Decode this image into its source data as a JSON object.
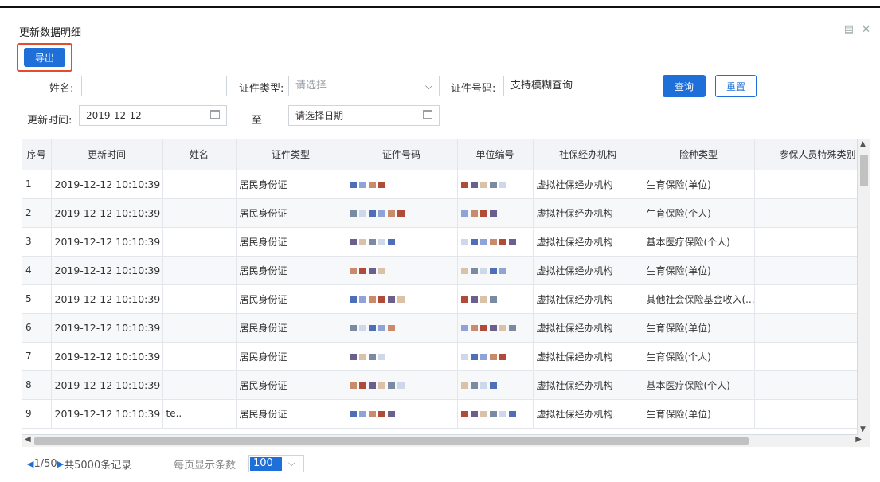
{
  "window": {
    "title": "更新数据明细"
  },
  "toolbar": {
    "export_label": "导出"
  },
  "filters": {
    "name_label": "姓名:",
    "id_type_label": "证件类型:",
    "id_type_placeholder": "请选择",
    "id_no_label": "证件号码:",
    "id_no_value": "支持模糊查询",
    "update_time_label": "更新时间:",
    "update_time_from": "2019-12-12",
    "to_label": "至",
    "update_time_to_placeholder": "请选择日期",
    "search_label": "查询",
    "reset_label": "重置"
  },
  "table": {
    "columns": [
      "序号",
      "更新时间",
      "姓名",
      "证件类型",
      "证件号码",
      "单位编号",
      "社保经办机构",
      "险种类型",
      "参保人员特殊类别"
    ],
    "rows": [
      {
        "no": "1",
        "time": "2019-12-12 10:10:39",
        "name": "",
        "id_type": "居民身份证",
        "agency": "虚拟社保经办机构",
        "insurance": "生育保险(单位)"
      },
      {
        "no": "2",
        "time": "2019-12-12 10:10:39",
        "name": "",
        "id_type": "居民身份证",
        "agency": "虚拟社保经办机构",
        "insurance": "生育保险(个人)"
      },
      {
        "no": "3",
        "time": "2019-12-12 10:10:39",
        "name": "",
        "id_type": "居民身份证",
        "agency": "虚拟社保经办机构",
        "insurance": "基本医疗保险(个人)"
      },
      {
        "no": "4",
        "time": "2019-12-12 10:10:39",
        "name": "",
        "id_type": "居民身份证",
        "agency": "虚拟社保经办机构",
        "insurance": "生育保险(单位)"
      },
      {
        "no": "5",
        "time": "2019-12-12 10:10:39",
        "name": "",
        "id_type": "居民身份证",
        "agency": "虚拟社保经办机构",
        "insurance": "其他社会保险基金收入(..."
      },
      {
        "no": "6",
        "time": "2019-12-12 10:10:39",
        "name": "",
        "id_type": "居民身份证",
        "agency": "虚拟社保经办机构",
        "insurance": "生育保险(单位)"
      },
      {
        "no": "7",
        "time": "2019-12-12 10:10:39",
        "name": "",
        "id_type": "居民身份证",
        "agency": "虚拟社保经办机构",
        "insurance": "生育保险(个人)"
      },
      {
        "no": "8",
        "time": "2019-12-12 10:10:39",
        "name": "",
        "id_type": "居民身份证",
        "agency": "虚拟社保经办机构",
        "insurance": "基本医疗保险(个人)"
      },
      {
        "no": "9",
        "time": "2019-12-12 10:10:39",
        "name": "te..",
        "id_type": "居民身份证",
        "agency": "虚拟社保经办机构",
        "insurance": "生育保险(单位)"
      }
    ]
  },
  "pager": {
    "page_info": "1/50",
    "total": "共5000条记录",
    "per_page_label": "每页显示条数",
    "per_page_value": "100"
  },
  "colors": {
    "accent": "#1f6fd8",
    "highlight_border": "#e54b2c"
  }
}
